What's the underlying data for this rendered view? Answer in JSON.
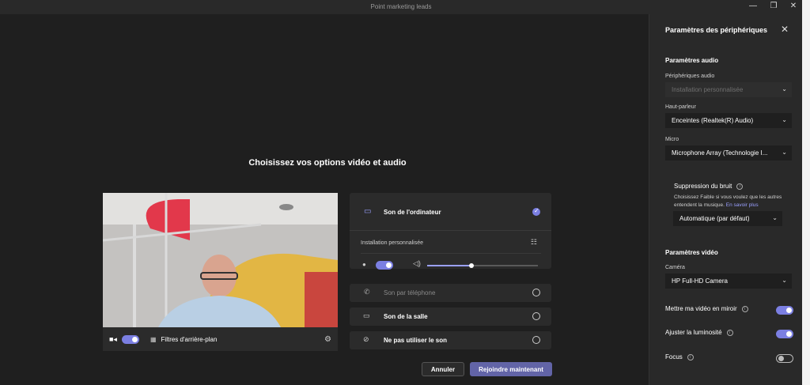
{
  "window": {
    "title": "Point marketing leads",
    "minimize": "—",
    "restore": "❐",
    "close": "✕"
  },
  "prejoin": {
    "headline": "Choisissez vos options vidéo et audio",
    "video_bar": {
      "bg_filters_label": "Filtres d'arrière-plan"
    },
    "audio_options": {
      "computer": "Son de l'ordinateur",
      "custom_setup": "Installation personnalisée",
      "phone": "Son par téléphone",
      "room": "Son de la salle",
      "none": "Ne pas utiliser le son"
    },
    "volume_fraction": 0.4,
    "cancel_label": "Annuler",
    "join_label": "Rejoindre maintenant"
  },
  "panel": {
    "title": "Paramètres des périphériques",
    "audio_section": "Paramètres audio",
    "audio_devices_label": "Périphériques audio",
    "audio_devices_value": "Installation personnalisée",
    "speaker_label": "Haut-parleur",
    "speaker_value": "Enceintes (Realtek(R) Audio)",
    "mic_label": "Micro",
    "mic_value": "Microphone Array (Technologie I...",
    "noise_title": "Suppression du bruit",
    "noise_desc": "Choisissez Faible si vous voulez que les autres entendent la musique.",
    "noise_link": "En savoir plus",
    "noise_value": "Automatique (par défaut)",
    "video_section": "Paramètres vidéo",
    "camera_label": "Caméra",
    "camera_value": "HP Full-HD Camera",
    "mirror_label": "Mettre ma vidéo en miroir",
    "brightness_label": "Ajuster la luminosité",
    "focus_label": "Focus"
  },
  "colors": {
    "accent": "#7b7fe2",
    "join_button": "#6264a7",
    "background": "#1f1f1f",
    "panel": "#292929"
  }
}
